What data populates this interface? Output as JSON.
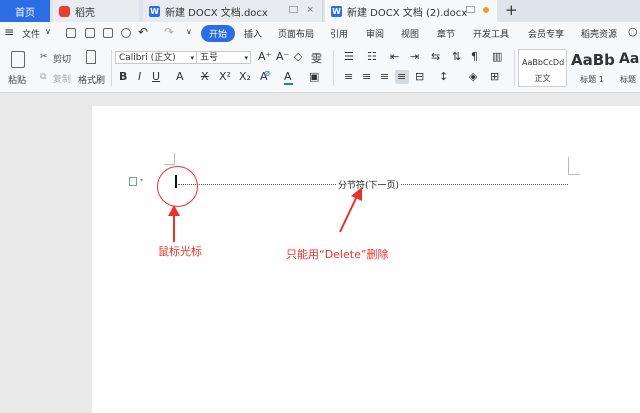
{
  "tabs": {
    "home": "首页",
    "daoke": "稻壳",
    "doc1": "新建 DOCX 文档.docx",
    "doc2": "新建 DOCX 文档 (2).docx",
    "doc_icon_letter": "W"
  },
  "menu": {
    "file": "文件",
    "start": "开始",
    "items": [
      "插入",
      "页面布局",
      "引用",
      "审阅",
      "视图",
      "章节",
      "开发工具",
      "会员专享",
      "稻壳资源"
    ]
  },
  "ribbon": {
    "paste": "粘贴",
    "cut": "剪切",
    "copy": "复制",
    "format_painter": "格式刷",
    "font_name": "Calibri (正文)",
    "font_size": "五号",
    "styles": [
      {
        "sample": "AaBbCcDd",
        "name": "正文"
      },
      {
        "sample": "AaBb",
        "name": "标题 1"
      },
      {
        "sample": "AaE",
        "name": "标题"
      }
    ]
  },
  "document": {
    "section_break": "分节符(下一页)",
    "annotation_cursor": "鼠标光标",
    "annotation_delete": "只能用“Delete”删除"
  },
  "colors": {
    "accent": "#2b6de4",
    "annotation": "#e8332a",
    "tab_bar": "#dfe3ea",
    "canvas": "#e9e9e9"
  }
}
